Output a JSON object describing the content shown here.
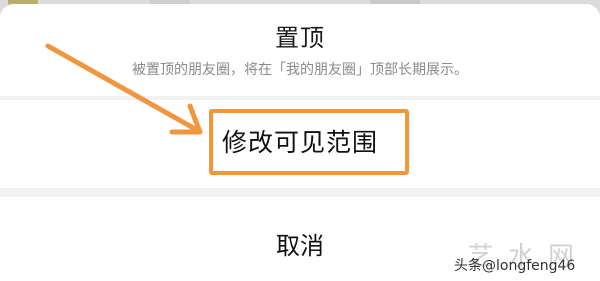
{
  "sheet": {
    "pin": {
      "title": "置顶",
      "description": "被置顶的朋友圈，将在「我的朋友圈」顶部长期展示。"
    },
    "scope": {
      "label": "修改可见范围"
    },
    "cancel": {
      "label": "取消"
    }
  },
  "annotation": {
    "color": "#f0963f"
  },
  "watermark": {
    "logo": "艺水网",
    "text": "头条@longfeng46"
  }
}
